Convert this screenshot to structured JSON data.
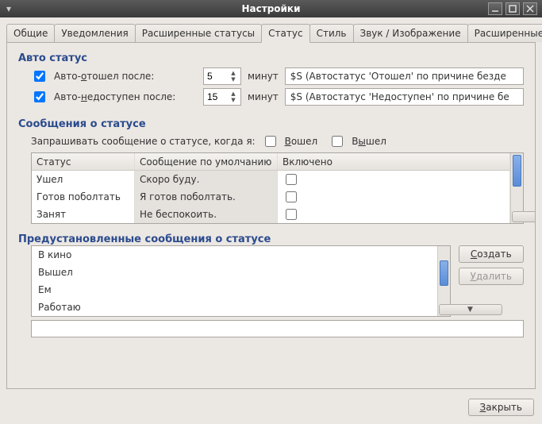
{
  "window_title": "Настройки",
  "tabs": [
    "Общие",
    "Уведомления",
    "Расширенные статусы",
    "Статус",
    "Стиль",
    "Звук / Изображение",
    "Расширенные"
  ],
  "active_tab": 3,
  "auto_status": {
    "title": "Авто статус",
    "away_label_pre": "Авто-",
    "away_label_u": "о",
    "away_label_post": "тошел после:",
    "away_value": "5",
    "away_unit": "минут",
    "away_msg": "$S (Автостатус 'Отошел' по причине безде",
    "na_label_pre": "Авто-",
    "na_label_u": "н",
    "na_label_post": "едоступен после:",
    "na_value": "15",
    "na_unit": "минут",
    "na_msg": "$S (Автостатус 'Недоступен' по причине бе"
  },
  "status_messages": {
    "title": "Сообщения о статусе",
    "prompt_label": "Запрашивать сообщение о статусе, когда я:",
    "entered_u": "В",
    "entered_post": "ошел",
    "left_pre": "В",
    "left_u": "ы",
    "left_post": "шел",
    "col_status": "Статус",
    "col_default": "Сообщение по умолчанию",
    "col_enabled": "Включено",
    "rows": [
      {
        "status": "Ушел",
        "msg": "Скоро буду.",
        "enabled": false
      },
      {
        "status": "Готов поболтать",
        "msg": "Я готов поболтать.",
        "enabled": false
      },
      {
        "status": "Занят",
        "msg": "Не беспокоить.",
        "enabled": false
      }
    ]
  },
  "presets": {
    "title": "Предустановленные сообщения о статусе",
    "items": [
      "В кино",
      "Вышел",
      "Ем",
      "Работаю"
    ],
    "create_u": "С",
    "create_post": "оздать",
    "delete_u": "У",
    "delete_post": "далить"
  },
  "close_u": "З",
  "close_post": "акрыть"
}
